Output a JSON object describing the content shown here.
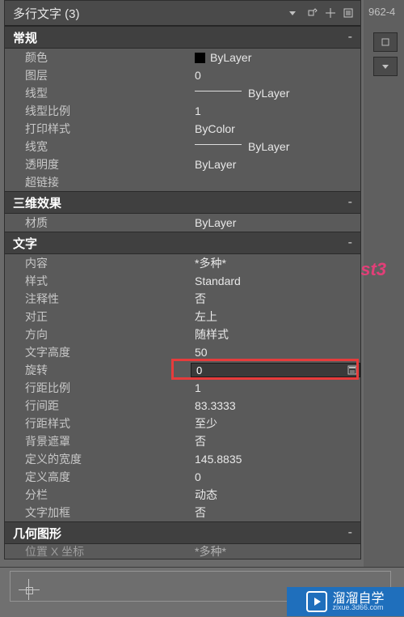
{
  "header": {
    "title": "多行文字 (3)"
  },
  "right": {
    "corner_text": "962-4"
  },
  "categories": {
    "general": {
      "title": "常规",
      "color": {
        "label": "颜色",
        "value": "ByLayer"
      },
      "layer": {
        "label": "图层",
        "value": "0"
      },
      "linetype": {
        "label": "线型",
        "value": "ByLayer"
      },
      "lt_scale": {
        "label": "线型比例",
        "value": "1"
      },
      "plot_style": {
        "label": "打印样式",
        "value": "ByColor"
      },
      "lineweight": {
        "label": "线宽",
        "value": "ByLayer"
      },
      "transparency": {
        "label": "透明度",
        "value": "ByLayer"
      },
      "hyperlink": {
        "label": "超链接",
        "value": ""
      }
    },
    "visual3d": {
      "title": "三维效果",
      "material": {
        "label": "材质",
        "value": "ByLayer"
      }
    },
    "text": {
      "title": "文字",
      "contents": {
        "label": "内容",
        "value": "*多种*"
      },
      "style": {
        "label": "样式",
        "value": "Standard"
      },
      "annotative": {
        "label": "注释性",
        "value": "否"
      },
      "justify": {
        "label": "对正",
        "value": "左上"
      },
      "direction": {
        "label": "方向",
        "value": "随样式"
      },
      "text_height": {
        "label": "文字高度",
        "value": "50"
      },
      "rotation": {
        "label": "旋转",
        "value": "0"
      },
      "line_scale": {
        "label": "行距比例",
        "value": "1"
      },
      "line_space": {
        "label": "行间距",
        "value": "83.3333"
      },
      "space_style": {
        "label": "行距样式",
        "value": "至少"
      },
      "bg_mask": {
        "label": "背景遮罩",
        "value": "否"
      },
      "def_width": {
        "label": "定义的宽度",
        "value": "145.8835"
      },
      "def_height": {
        "label": "定义高度",
        "value": "0"
      },
      "columns": {
        "label": "分栏",
        "value": "动态"
      },
      "text_frame": {
        "label": "文字加框",
        "value": "否"
      }
    },
    "geometry": {
      "title": "几何图形",
      "pos_x": {
        "label": "位置 X 坐标",
        "value": "*多种*"
      }
    }
  },
  "pink_label": "st3",
  "watermark": {
    "text": "溜溜自学",
    "sub": "zixue.3d66.com"
  }
}
